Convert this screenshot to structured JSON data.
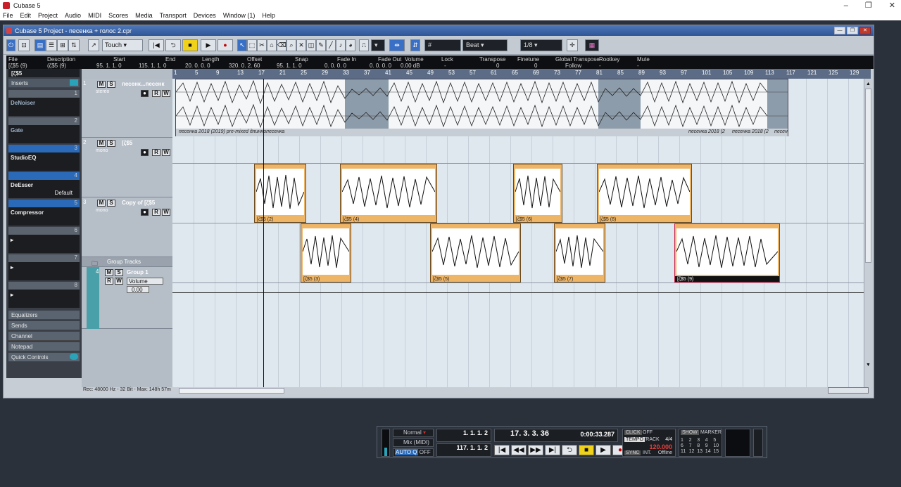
{
  "app": {
    "title": "Cubase 5",
    "window_controls": [
      "–",
      "❐",
      "✕"
    ]
  },
  "menu": [
    "File",
    "Edit",
    "Project",
    "Audio",
    "MIDI",
    "Scores",
    "Media",
    "Transport",
    "Devices",
    "Window (1)",
    "Help"
  ],
  "project": {
    "title": "Cubase 5 Project - песенка + голос 2.cpr"
  },
  "toolbar": {
    "automation_mode": "Touch",
    "snap_type": "Beat",
    "quantize": "1/8",
    "snap_value": "#"
  },
  "infoline": {
    "headers": [
      "File",
      "Description",
      "Start",
      "End",
      "Length",
      "Offset",
      "Snap",
      "Fade In",
      "Fade Out",
      "Volume",
      "Lock",
      "Transpose",
      "Finetune",
      "Global Transpose",
      "Rootkey",
      "Mute"
    ],
    "values": [
      "[ζ$5 (9)",
      "(ζ$5 (9)",
      "95. 1. 1.  0",
      "115. 1. 1.  0",
      "20. 0. 0.  0",
      "320. 0. 2. 60",
      "95. 1. 1.  0",
      "0. 0. 0.  0",
      "0. 0. 0.  0",
      "0.00 dB",
      "-",
      "0",
      "0",
      "Follow",
      "-",
      "-"
    ]
  },
  "inspector": {
    "track_name": "[ζ$5",
    "inserts_label": "Inserts",
    "slots": [
      {
        "num": "1",
        "name": "DeNoiser"
      },
      {
        "num": "2",
        "name": "Gate"
      },
      {
        "num": "3",
        "name": "StudioEQ"
      },
      {
        "num": "4",
        "name": "DeEsser",
        "preset": "Default"
      },
      {
        "num": "5",
        "name": "Compressor"
      },
      {
        "num": "6",
        "name": ""
      },
      {
        "num": "7",
        "name": ""
      },
      {
        "num": "8",
        "name": ""
      }
    ],
    "sections": [
      "Equalizers",
      "Sends",
      "Channel",
      "Notepad",
      "Quick Controls"
    ]
  },
  "tracks": [
    {
      "num": "1",
      "name": "песенк...песенк",
      "type": "stereo"
    },
    {
      "num": "2",
      "name": "[ζ$5",
      "type": "mono"
    },
    {
      "num": "3",
      "name": "Copy of [ζ$5",
      "type": "mono"
    },
    {
      "num": "",
      "name": "Group Tracks",
      "type": ""
    },
    {
      "num": "4",
      "name": "Group 1",
      "type": "",
      "volume_label": "Volume",
      "volume_value": "0.00"
    }
  ],
  "ruler": [
    "1",
    "5",
    "9",
    "13",
    "17",
    "21",
    "25",
    "29",
    "33",
    "37",
    "41",
    "45",
    "49",
    "53",
    "57",
    "61",
    "65",
    "69",
    "73",
    "77",
    "81",
    "85",
    "89",
    "93",
    "97",
    "101",
    "105",
    "109",
    "113",
    "117",
    "121",
    "125",
    "129"
  ],
  "audio_track1": {
    "label": "песенка 2018 (2019) pre-mixed длиннопесенка",
    "label_end1": "песенка 2018 (2",
    "label_end2": "песенка 2018 (2",
    "label_end3": "песен"
  },
  "events_track2": [
    {
      "label": "[ζ$5 (2)"
    },
    {
      "label": "[ζ$5 (4)"
    },
    {
      "label": "[ζ$5 (6)"
    },
    {
      "label": "[ζ$5 (8)"
    }
  ],
  "events_track3": [
    {
      "label": "[ζ$5 (3)"
    },
    {
      "label": "[ζ$5 (5)"
    },
    {
      "label": "[ζ$5 (7)"
    },
    {
      "label": "[ζ$5 (9)"
    }
  ],
  "status_bar": "Rec: 48000 Hz - 32 Bit - Max: 148h 57m",
  "transport": {
    "mode": "Normal",
    "mix": "Mix (MIDI)",
    "auto_q": "AUTO Q",
    "auto_q_state": "OFF",
    "left_locator": "1. 1. 1.   2",
    "right_locator": "117. 1. 1.   2",
    "position": "17.  3.  3.  36",
    "time": "0:00:33.287",
    "click": "CLICK",
    "click_state": "OFF",
    "tempo_label": "TEMPO",
    "track_label": "TRACK",
    "signature": "4/4",
    "tempo": "120.000",
    "sync": "SYNC",
    "int": "INT.",
    "offline": "Offline",
    "show": "SHOW",
    "marker": "MARKER",
    "markers": [
      "1",
      "2",
      "3",
      "4",
      "5",
      "6",
      "7",
      "8",
      "9",
      "10",
      "11",
      "12",
      "13",
      "14",
      "15"
    ]
  }
}
